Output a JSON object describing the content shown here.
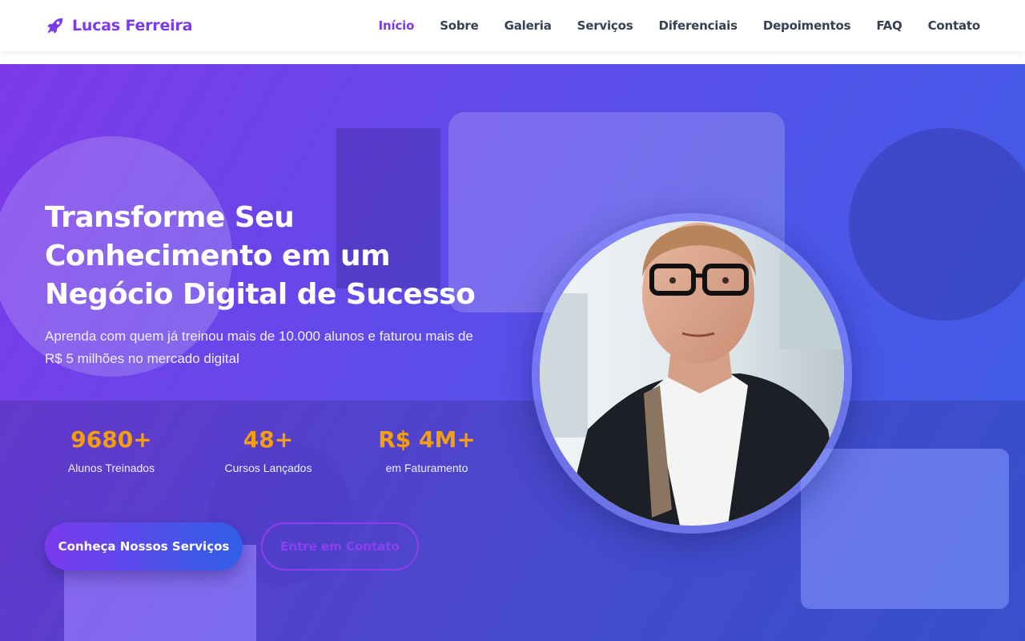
{
  "brand": {
    "name": "Lucas Ferreira",
    "icon": "rocket-icon",
    "color": "#7c3aed"
  },
  "nav": {
    "items": [
      {
        "label": "Início",
        "active": true
      },
      {
        "label": "Sobre",
        "active": false
      },
      {
        "label": "Galeria",
        "active": false
      },
      {
        "label": "Serviços",
        "active": false
      },
      {
        "label": "Diferenciais",
        "active": false
      },
      {
        "label": "Depoimentos",
        "active": false
      },
      {
        "label": "FAQ",
        "active": false
      },
      {
        "label": "Contato",
        "active": false
      }
    ]
  },
  "hero": {
    "title": "Transforme Seu Conhecimento em um Negócio Digital de Sucesso",
    "subtitle": "Aprenda com quem já treinou mais de 10.000 alunos e faturou mais de R$ 5 milhões no mercado digital",
    "stats": [
      {
        "value": "9680+",
        "label": "Alunos Treinados"
      },
      {
        "value": "48+",
        "label": "Cursos Lançados"
      },
      {
        "value": "R$ 4M+",
        "label": "em Faturamento"
      }
    ],
    "primary_button": "Conheça Nossos Serviços",
    "secondary_button": "Entre em Contato"
  },
  "colors": {
    "accent": "#7c3aed",
    "stat_value": "#f59e0b",
    "gradient_start": "#7e3aea",
    "gradient_end": "#3d5ce6"
  }
}
